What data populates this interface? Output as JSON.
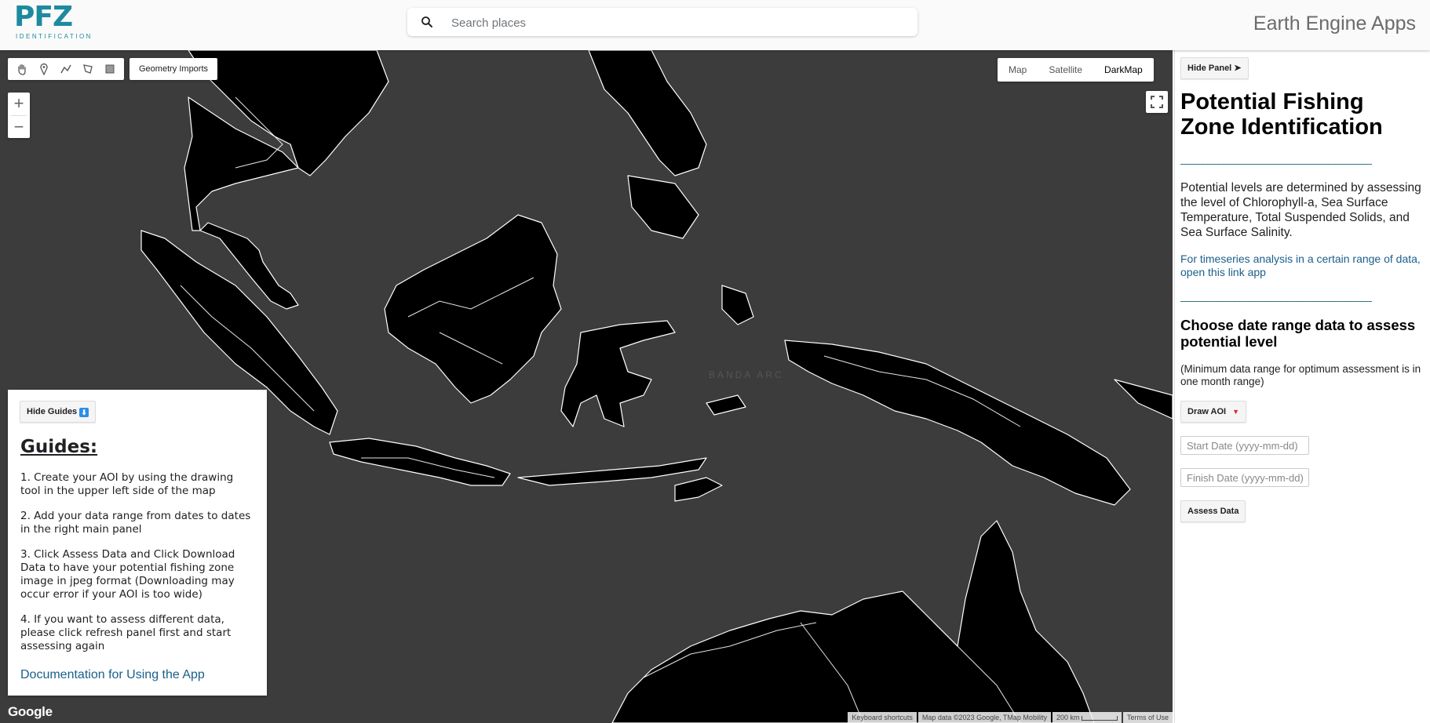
{
  "header": {
    "logo_main": "PFZ",
    "logo_sub": "IDENTIFICATION",
    "search_placeholder": "Search places",
    "app_title": "Earth Engine Apps"
  },
  "map": {
    "geometry_imports_label": "Geometry Imports",
    "zoom_in_label": "+",
    "zoom_out_label": "−",
    "map_types": [
      "Map",
      "Satellite",
      "DarkMap"
    ],
    "active_map_type": "DarkMap",
    "google_label": "Google",
    "attribution": {
      "keyboard": "Keyboard shortcuts",
      "map_data": "Map data ©2023 Google, TMap Mobility",
      "scale": "200 km",
      "terms": "Terms of Use"
    },
    "background_color": "#3c3c3c",
    "land_color": "#000000",
    "road_color": "#ffffff",
    "labels": [
      "BANDA ARC"
    ]
  },
  "guides": {
    "hide_label": "Hide Guides",
    "title": "Guides:",
    "steps": [
      "1. Create your AOI by using the drawing tool in the upper left side of the map",
      "2. Add your data range from dates to dates in the right main panel",
      "3. Click Assess Data and Click Download Data to have your potential fishing zone image in jpeg format (Downloading may occur error if your AOI is too wide)",
      "4. If you want to assess different data, please click refresh panel first and start assessing again"
    ],
    "doc_link": "Documentation for Using the App"
  },
  "panel": {
    "hide_label": "Hide Panel ➤",
    "title": "Potential Fishing Zone Identification",
    "divider": "____________________________________",
    "description": "Potential levels are determined by assessing the level of Chlorophyll-a, Sea Surface Temperature, Total Suspended Solids, and Sea Surface Salinity.",
    "timeseries_link": "For timeseries analysis in a certain range of data, open this link app",
    "section_title": "Choose date range data to assess potential level",
    "note": "(Minimum data range for optimum assessment is in one month range)",
    "draw_aoi_label": "Draw AOI",
    "start_placeholder": "Start Date (yyyy-mm-dd)",
    "finish_placeholder": "Finish Date (yyyy-mm-dd)",
    "assess_label": "Assess Data"
  }
}
